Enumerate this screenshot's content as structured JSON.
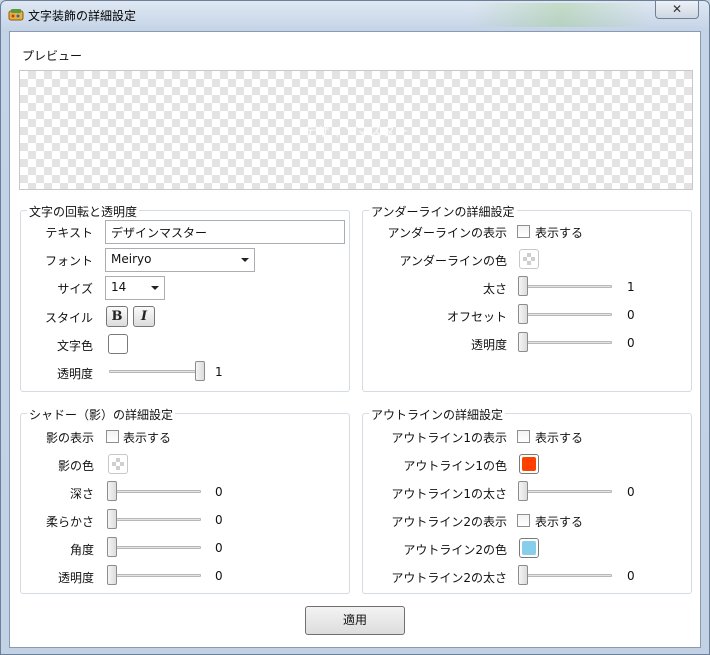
{
  "window": {
    "title": "文字装飾の詳細設定",
    "close_glyph": "✕"
  },
  "preview": {
    "label": "プレビュー",
    "text": "デザインマスター"
  },
  "rotation_group": {
    "title": "文字の回転と透明度",
    "text_label": "テキスト",
    "text_value": "デザインマスター",
    "font_label": "フォント",
    "font_value": "Meiryo",
    "size_label": "サイズ",
    "size_value": "14",
    "style_label": "スタイル",
    "bold_glyph": "B",
    "italic_glyph": "I",
    "color_label": "文字色",
    "opacity_label": "透明度",
    "opacity_value": "1"
  },
  "underline_group": {
    "title": "アンダーラインの詳細設定",
    "show_label": "アンダーラインの表示",
    "show_checkbox_label": "表示する",
    "show_checked": false,
    "color_label": "アンダーラインの色",
    "thickness_label": "太さ",
    "thickness_value": "1",
    "offset_label": "オフセット",
    "offset_value": "0",
    "opacity_label": "透明度",
    "opacity_value": "0"
  },
  "shadow_group": {
    "title": "シャドー（影）の詳細設定",
    "show_label": "影の表示",
    "show_checkbox_label": "表示する",
    "show_checked": false,
    "color_label": "影の色",
    "depth_label": "深さ",
    "depth_value": "0",
    "softness_label": "柔らかさ",
    "softness_value": "0",
    "angle_label": "角度",
    "angle_value": "0",
    "opacity_label": "透明度",
    "opacity_value": "0"
  },
  "outline_group": {
    "title": "アウトラインの詳細設定",
    "outline1_show_label": "アウトライン1の表示",
    "outline1_checkbox_label": "表示する",
    "outline1_checked": false,
    "outline1_color_label": "アウトライン1の色",
    "outline1_color": "#ff4000",
    "outline1_thickness_label": "アウトライン1の太さ",
    "outline1_thickness_value": "0",
    "outline2_show_label": "アウトライン2の表示",
    "outline2_checkbox_label": "表示する",
    "outline2_checked": false,
    "outline2_color_label": "アウトライン2の色",
    "outline2_color": "#87ceeb",
    "outline2_thickness_label": "アウトライン2の太さ",
    "outline2_thickness_value": "0"
  },
  "apply_label": "適用"
}
